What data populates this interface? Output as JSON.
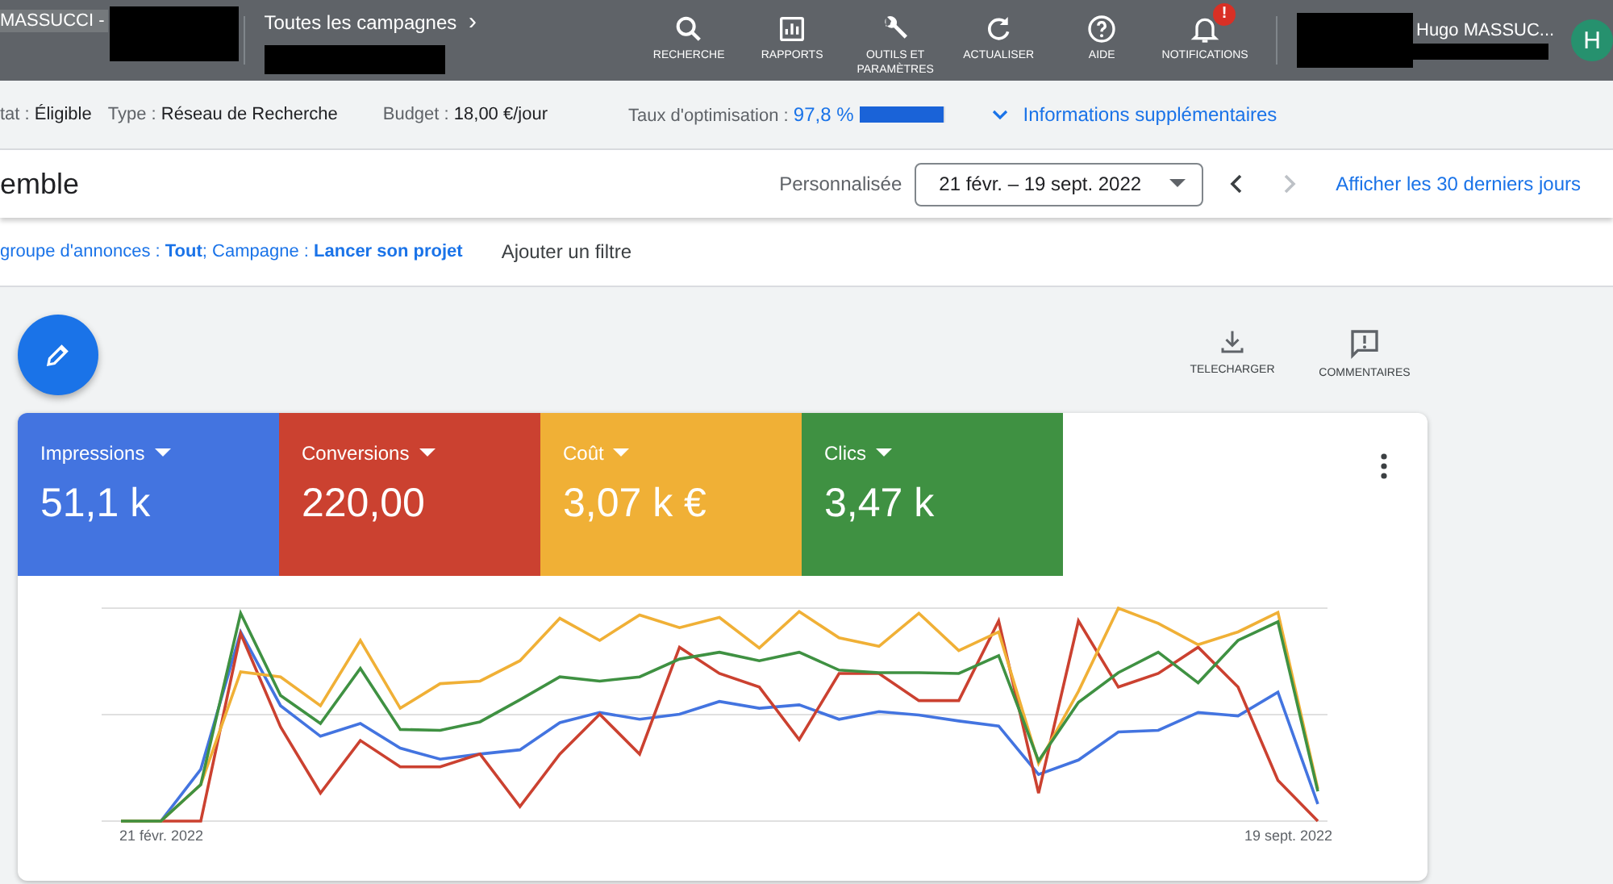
{
  "top_bar": {
    "account": "MASSUCCI -",
    "breadcrumb": "Toutes les campagnes",
    "breadcrumb_chevron": "›",
    "tools": [
      {
        "kind": "search",
        "label": "RECHERCHE"
      },
      {
        "kind": "reports",
        "label": "RAPPORTS"
      },
      {
        "kind": "tools",
        "label": "OUTILS ET PARAMÈTRES"
      },
      {
        "kind": "refresh",
        "label": "ACTUALISER"
      },
      {
        "kind": "help",
        "label": "AIDE"
      },
      {
        "kind": "notifications",
        "label": "NOTIFICATIONS",
        "badge": "!"
      }
    ],
    "user_name": "Hugo MASSUC...",
    "avatar": "H"
  },
  "info_bar": {
    "items": [
      {
        "label": "tat :",
        "value": "Éligible"
      },
      {
        "label": "Type :",
        "value": "Réseau de Recherche"
      },
      {
        "label": "Budget :",
        "value": "18,00 €/jour"
      }
    ],
    "optimization": {
      "label": "Taux d'optimisation :",
      "value": "97,8 %",
      "level": 0.978
    },
    "more_info": "Informations supplémentaires"
  },
  "title_bar": {
    "title": "emble",
    "range_label": "Personnalisée",
    "date_range": "21 févr. – 19 sept. 2022",
    "next_disabled": true,
    "last_30_link": "Afficher les 30 derniers jours"
  },
  "filter_bar": {
    "filter": "groupe d'annonces : **Tout**; Campagne : **Lancer son projet**",
    "add_filter": "Ajouter un filtre"
  },
  "actions": [
    {
      "kind": "download",
      "label": "TELECHARGER"
    },
    {
      "kind": "comments",
      "label": "COMMENTAIRES"
    }
  ],
  "metrics": [
    {
      "label": "Impressions",
      "value": "51,1 k",
      "color": "#4374e0",
      "selected": true
    },
    {
      "label": "Conversions",
      "value": "220,00",
      "color": "#cb4130",
      "selected": true
    },
    {
      "label": "Coût",
      "value": "3,07 k €",
      "color": "#f0b036",
      "selected": true
    },
    {
      "label": "Clics",
      "value": "3,47 k",
      "color": "#3f9142",
      "selected": true
    }
  ],
  "chart": {
    "x_start": "21 févr. 2022",
    "x_end": "19 sept. 2022"
  }
}
